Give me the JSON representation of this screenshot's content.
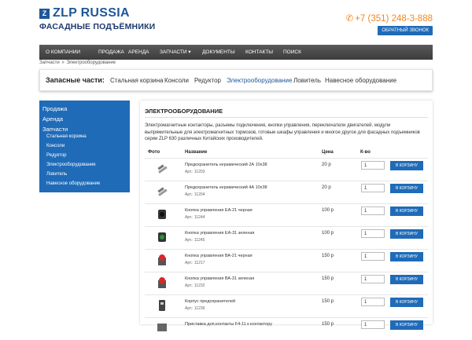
{
  "header": {
    "logo_mark": "Z",
    "logo_text": "ZLP RUSSIA",
    "logo_sub": "ФАСАДНЫЕ ПОДЪЁМНИКИ",
    "phone": "+7 (351) 248-3-888",
    "callback": "ОБРАТНЫЙ ЗВОНОК"
  },
  "nav": [
    "О КОМПАНИИ",
    "ПРОДАЖА",
    "АРЕНДА",
    "ЗАПЧАСТИ ▾",
    "ДОКУМЕНТЫ",
    "КОНТАКТЫ",
    "ПОИСК"
  ],
  "breadcrumb": {
    "root": "Запчасти",
    "sep": "»",
    "current": "Электрооборудование"
  },
  "parts": {
    "title": "Запасные части:",
    "items": [
      "Стальная корзина",
      "Консоли",
      "Редуктор",
      "Электрооборудование",
      "Ловитель",
      "Навесное оборудование"
    ]
  },
  "sidebar": {
    "main": [
      "Продажа",
      "Аренда",
      "Запчасти"
    ],
    "sub": [
      "Стальная корзина",
      "Консоли",
      "Редуктор",
      "Электрооборудование",
      "Ловитель",
      "Навесное оборудование"
    ]
  },
  "content": {
    "title": "ЭЛЕКТРООБОРУДОВАНИЕ",
    "description": "Электромагнитные контакторы, разъемы подключения, кнопки управления, переключатели двигателей, модули выпрямительные для электромагнитных тормозов, готовые шкафы управления и многое другое для фасадных подъемников серии ZLP 630 различных Китайских производителей.",
    "headers": {
      "photo": "Фото",
      "name": "Название",
      "price": "Цена",
      "qty": "К-во"
    },
    "cart_label": "В КОРЗИНУ",
    "rows": [
      {
        "name": "Предохранитель керамический 2А 10х38",
        "art": "Арт.: 11203",
        "price": "20 р",
        "qty": "1",
        "icon": "fuse"
      },
      {
        "name": "Предохранитель керамический 4А 10х38",
        "art": "Арт.: 11204",
        "price": "20 р",
        "qty": "1",
        "icon": "fuse"
      },
      {
        "name": "Кнопка управления ЕА-21 черная",
        "art": "Арт.: 11244",
        "price": "100 р",
        "qty": "1",
        "icon": "button-black"
      },
      {
        "name": "Кнопка управления ЕА-31 зеленая",
        "art": "Арт.: 11245",
        "price": "100 р",
        "qty": "1",
        "icon": "button-green"
      },
      {
        "name": "Кнопка управления ВА-21 черная",
        "art": "Арт.: 11217",
        "price": "150 р",
        "qty": "1",
        "icon": "button-red"
      },
      {
        "name": "Кнопка управления ВА-31 зеленая",
        "art": "Арт.: 11232",
        "price": "150 р",
        "qty": "1",
        "icon": "button-red"
      },
      {
        "name": "Корпус предохранителей",
        "art": "Арт.: 11236",
        "price": "150 р",
        "qty": "1",
        "icon": "fuse-case"
      },
      {
        "name": "Приставка доп.контакты F4-11 к контактору",
        "art": "",
        "price": "150 р",
        "qty": "1",
        "icon": "contact"
      }
    ]
  },
  "colors": {
    "brand": "#1f6bb8",
    "phone": "#f2871e",
    "nav": "#4a4a4a"
  }
}
